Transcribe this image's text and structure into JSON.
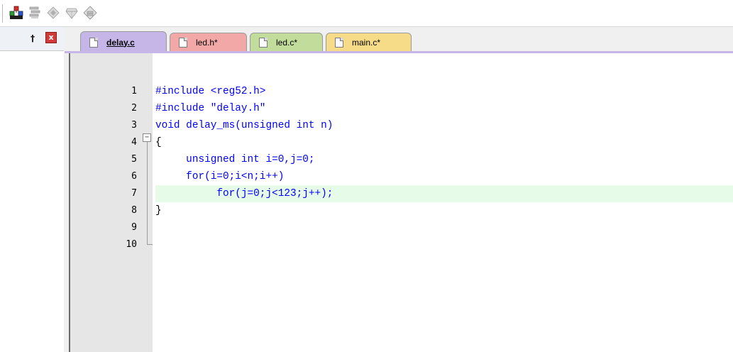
{
  "toolbar": {
    "buttons": [
      {
        "icon": "build-target-icon"
      },
      {
        "icon": "batch-build-icon"
      },
      {
        "icon": "translate-icon"
      },
      {
        "icon": "rebuild-icon"
      },
      {
        "icon": "stop-build-icon"
      }
    ]
  },
  "left_panel": {
    "pin_glyph": "†",
    "close_glyph": "x"
  },
  "tabs": [
    {
      "label": "delay.c",
      "active": true,
      "color": "#c6b6e8"
    },
    {
      "label": "led.h*",
      "active": false,
      "color": "#f3a8a8"
    },
    {
      "label": "led.c*",
      "active": false,
      "color": "#c2dc9c"
    },
    {
      "label": "main.c*",
      "active": false,
      "color": "#f6dc88"
    }
  ],
  "editor": {
    "fold_glyph": "−",
    "current_line": 7,
    "lines": [
      {
        "num": "1",
        "text": "#include <reg52.h>"
      },
      {
        "num": "2",
        "text": "#include \"delay.h\""
      },
      {
        "num": "3",
        "text": "void delay_ms(unsigned int n)"
      },
      {
        "num": "4",
        "text": "{"
      },
      {
        "num": "5",
        "text": "     unsigned int i=0,j=0;"
      },
      {
        "num": "6",
        "text": "     for(i=0;i<n;i++)"
      },
      {
        "num": "7",
        "text": "          for(j=0;j<123;j++);"
      },
      {
        "num": "8",
        "text": "}"
      },
      {
        "num": "9",
        "text": ""
      },
      {
        "num": "10",
        "text": ""
      }
    ]
  }
}
